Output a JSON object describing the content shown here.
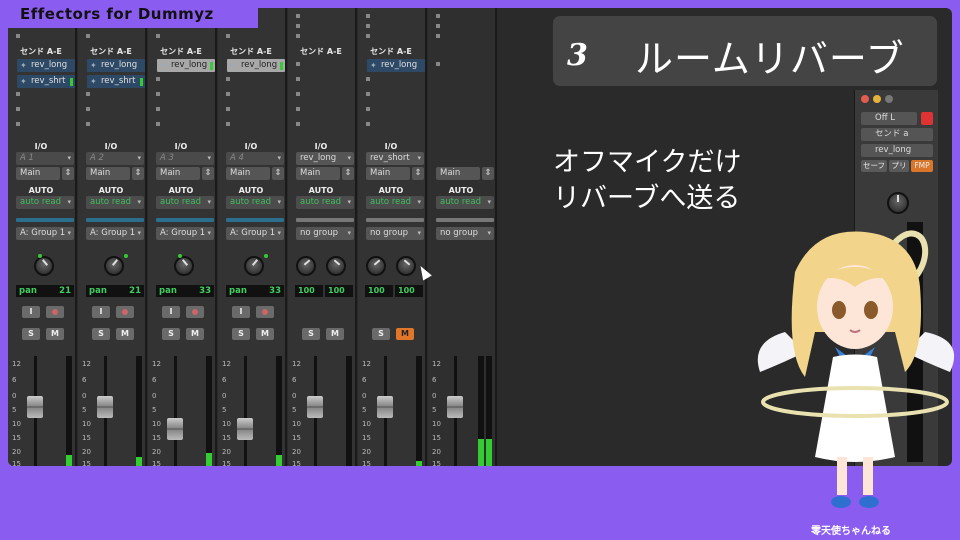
{
  "app_title": "Effectors for Dummyz",
  "headline": {
    "number": "3",
    "text": "ルームリバーブ"
  },
  "caption": {
    "line1": "オフマイクだけ",
    "line2": "リバーブへ送る"
  },
  "credit": "零天使ちゃんねる",
  "colors": {
    "background": "#8b5cf0",
    "mixer": "#2a2a2a",
    "strip": "#333333",
    "send_active": "#2d4966",
    "meter": "#33cc33",
    "solo_active": "#e0762a"
  },
  "strips": [
    {
      "sends_label": "センド A-E",
      "sends": [
        {
          "label": "rev_long",
          "style": "blue"
        },
        {
          "label": "rev_shrt",
          "style": "blue"
        }
      ],
      "io_label": "I/O",
      "input": "A 1",
      "input_dim": true,
      "output": "Main",
      "auto_label": "AUTO",
      "automation": "auto read",
      "group": "A: Group 1",
      "pan_type": "single",
      "pan_label": "pan",
      "pan_value": "21",
      "pan_side": "left",
      "solo": "S",
      "mute": "M",
      "solo_active": false,
      "meter_level": 0.1,
      "fader_level": 0.55
    },
    {
      "sends_label": "センド A-E",
      "sends": [
        {
          "label": "rev_long",
          "style": "blue"
        },
        {
          "label": "rev_shrt",
          "style": "blue"
        }
      ],
      "io_label": "I/O",
      "input": "A 2",
      "input_dim": true,
      "output": "Main",
      "auto_label": "AUTO",
      "automation": "auto read",
      "group": "A: Group 1",
      "pan_type": "single",
      "pan_label": "pan",
      "pan_value": "21",
      "pan_side": "right",
      "solo": "S",
      "mute": "M",
      "solo_active": false,
      "meter_level": 0.08,
      "fader_level": 0.55
    },
    {
      "sends_label": "センド A-E",
      "sends": [
        {
          "label": "rev_long",
          "style": "gray"
        }
      ],
      "io_label": "I/O",
      "input": "A 3",
      "input_dim": true,
      "output": "Main",
      "auto_label": "AUTO",
      "automation": "auto read",
      "group": "A: Group 1",
      "pan_type": "single",
      "pan_label": "pan",
      "pan_value": "33",
      "pan_side": "left",
      "solo": "S",
      "mute": "M",
      "solo_active": false,
      "meter_level": 0.12,
      "fader_level": 0.3
    },
    {
      "sends_label": "センド A-E",
      "sends": [
        {
          "label": "rev_long",
          "style": "gray"
        }
      ],
      "io_label": "I/O",
      "input": "A 4",
      "input_dim": true,
      "output": "Main",
      "auto_label": "AUTO",
      "automation": "auto read",
      "group": "A: Group 1",
      "pan_type": "single",
      "pan_label": "pan",
      "pan_value": "33",
      "pan_side": "right",
      "solo": "S",
      "mute": "M",
      "solo_active": false,
      "meter_level": 0.1,
      "fader_level": 0.3
    },
    {
      "sends_label": "センド A-E",
      "sends": [],
      "io_label": "I/O",
      "input": "rev_long",
      "input_dim": false,
      "output": "Main",
      "auto_label": "AUTO",
      "automation": "auto read",
      "group": "no group",
      "pan_type": "dual",
      "pan_left": "100",
      "pan_right": "100",
      "solo": "S",
      "mute": "M",
      "solo_active": false,
      "meter_level": 0.0,
      "fader_level": 0.55
    },
    {
      "sends_label": "センド A-E",
      "sends": [
        {
          "label": "rev_long",
          "style": "blue"
        }
      ],
      "io_label": "I/O",
      "input": "rev_short",
      "input_dim": false,
      "output": "Main",
      "auto_label": "AUTO",
      "automation": "auto read",
      "group": "no group",
      "pan_type": "dual",
      "pan_left": "100",
      "pan_right": "100",
      "solo": "S",
      "mute": "M",
      "solo_active": true,
      "meter_level": 0.05,
      "fader_level": 0.55
    },
    {
      "sends_label": "",
      "sends": [],
      "io_label": "",
      "input": "",
      "input_dim": false,
      "output": "Main",
      "auto_label": "AUTO",
      "automation": "auto read",
      "group": "no group",
      "pan_type": "none",
      "solo": "",
      "mute": "",
      "solo_active": false,
      "meter_level": 0.25,
      "fader_level": 0.55
    }
  ],
  "scale_labels": [
    "12",
    "6",
    "0",
    "5",
    "10",
    "15",
    "20",
    "15"
  ],
  "right_panel": {
    "output": "Off L",
    "send": "センド a",
    "target": "rev_long",
    "buttons": [
      "セーフ",
      "プリ",
      "FMP"
    ]
  }
}
